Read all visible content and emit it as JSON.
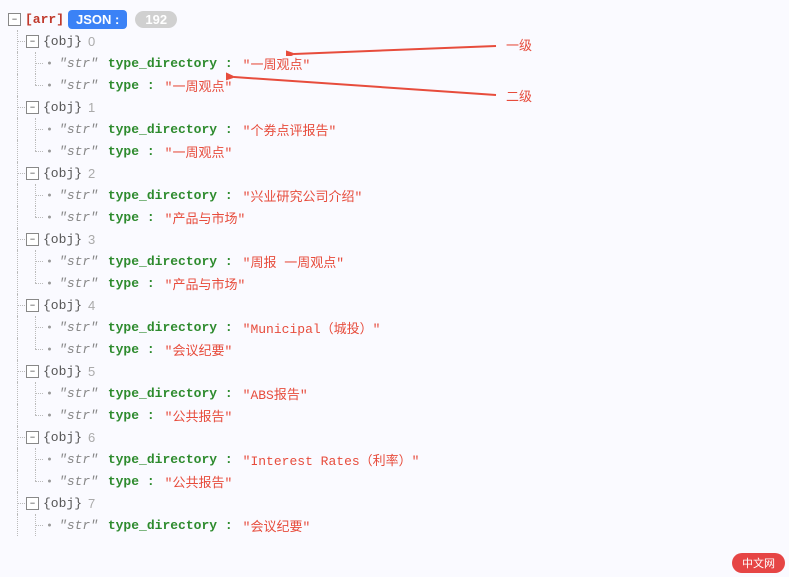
{
  "root": {
    "type_label": "[arr]",
    "json_label": "JSON :",
    "count": "192"
  },
  "annotations": {
    "level1": "一级",
    "level2": "二级"
  },
  "key_labels": {
    "type_directory": "type_directory :",
    "type": "type :"
  },
  "type_tags": {
    "obj": "{obj}",
    "str": "str"
  },
  "items": [
    {
      "idx": "0",
      "type_directory": "\"一周观点\"",
      "type": "\"一周观点\""
    },
    {
      "idx": "1",
      "type_directory": "\"个券点评报告\"",
      "type": "\"一周观点\""
    },
    {
      "idx": "2",
      "type_directory": "\"兴业研究公司介绍\"",
      "type": "\"产品与市场\""
    },
    {
      "idx": "3",
      "type_directory": "\"周报 一周观点\"",
      "type": "\"产品与市场\""
    },
    {
      "idx": "4",
      "type_directory": "\"Municipal（城投）\"",
      "type": "\"会议纪要\""
    },
    {
      "idx": "5",
      "type_directory": "\"ABS报告\"",
      "type": "\"公共报告\""
    },
    {
      "idx": "6",
      "type_directory": "\"Interest Rates（利率）\"",
      "type": "\"公共报告\""
    }
  ],
  "partial_item": {
    "idx": "7",
    "type_directory": "\"会议纪要\""
  },
  "logo_text": "中文网"
}
